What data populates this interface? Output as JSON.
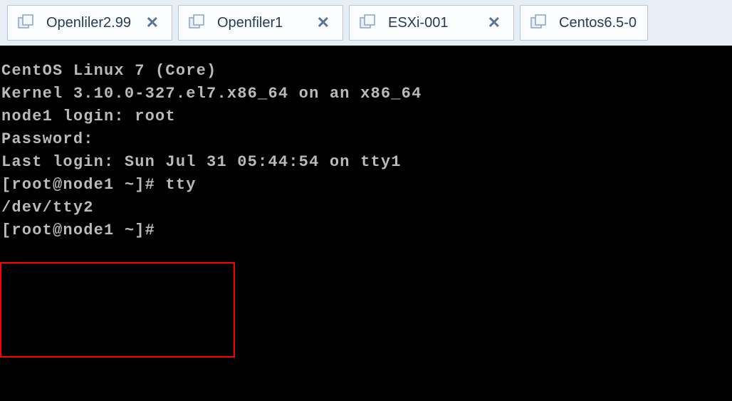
{
  "tabs": [
    {
      "label": "Openliler2.99",
      "closable": true
    },
    {
      "label": "Openfiler1",
      "closable": true
    },
    {
      "label": "ESXi-001",
      "closable": true
    },
    {
      "label": "Centos6.5-0",
      "closable": false
    }
  ],
  "terminal": {
    "line1": "CentOS Linux 7 (Core)",
    "line2": "Kernel 3.10.0-327.el7.x86_64 on an x86_64",
    "line3": "",
    "line4": "node1 login: root",
    "line5": "Password:",
    "line6": "Last login: Sun Jul 31 05:44:54 on tty1",
    "line7": "[root@node1 ~]# tty",
    "line8": "/dev/tty2",
    "line9": "[root@node1 ~]# "
  }
}
